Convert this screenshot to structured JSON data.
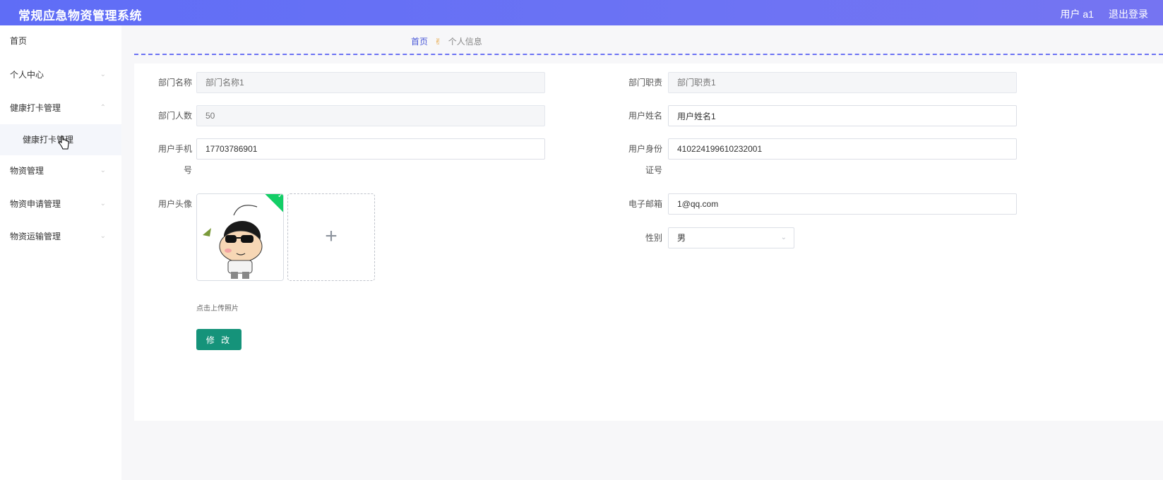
{
  "app": {
    "title": "常规应急物资管理系统",
    "user_label": "用户 a1",
    "logout_label": "退出登录",
    "accent_color": "#6c73f4",
    "button_color": "#15937a"
  },
  "sidebar": {
    "items": [
      {
        "label": "首页"
      },
      {
        "label": "个人中心"
      },
      {
        "label": "健康打卡管理"
      },
      {
        "label": "健康打卡管理"
      },
      {
        "label": "物资管理"
      },
      {
        "label": "物资申请管理"
      },
      {
        "label": "物资运输管理"
      }
    ]
  },
  "breadcrumb": {
    "home": "首页",
    "separator_icon": "hand-icon",
    "current": "个人信息"
  },
  "form": {
    "dept_name": {
      "label": "部门名称",
      "placeholder": "部门名称1"
    },
    "dept_duty": {
      "label": "部门职责",
      "placeholder": "部门职责1"
    },
    "dept_count": {
      "label": "部门人数",
      "placeholder": "50"
    },
    "user_name": {
      "label": "用户姓名",
      "value": "用户姓名1"
    },
    "phone": {
      "label_line1": "用户手机",
      "label_line2": "号",
      "value": "17703786901"
    },
    "id_card": {
      "label_line1": "用户身份",
      "label_line2": "证号",
      "value": "410224199610232001"
    },
    "avatar": {
      "label": "用户头像",
      "upload_tip": "点击上传照片"
    },
    "email": {
      "label": "电子邮箱",
      "value": "1@qq.com"
    },
    "gender": {
      "label": "性别",
      "value": "男"
    },
    "submit_label": "修 改"
  }
}
